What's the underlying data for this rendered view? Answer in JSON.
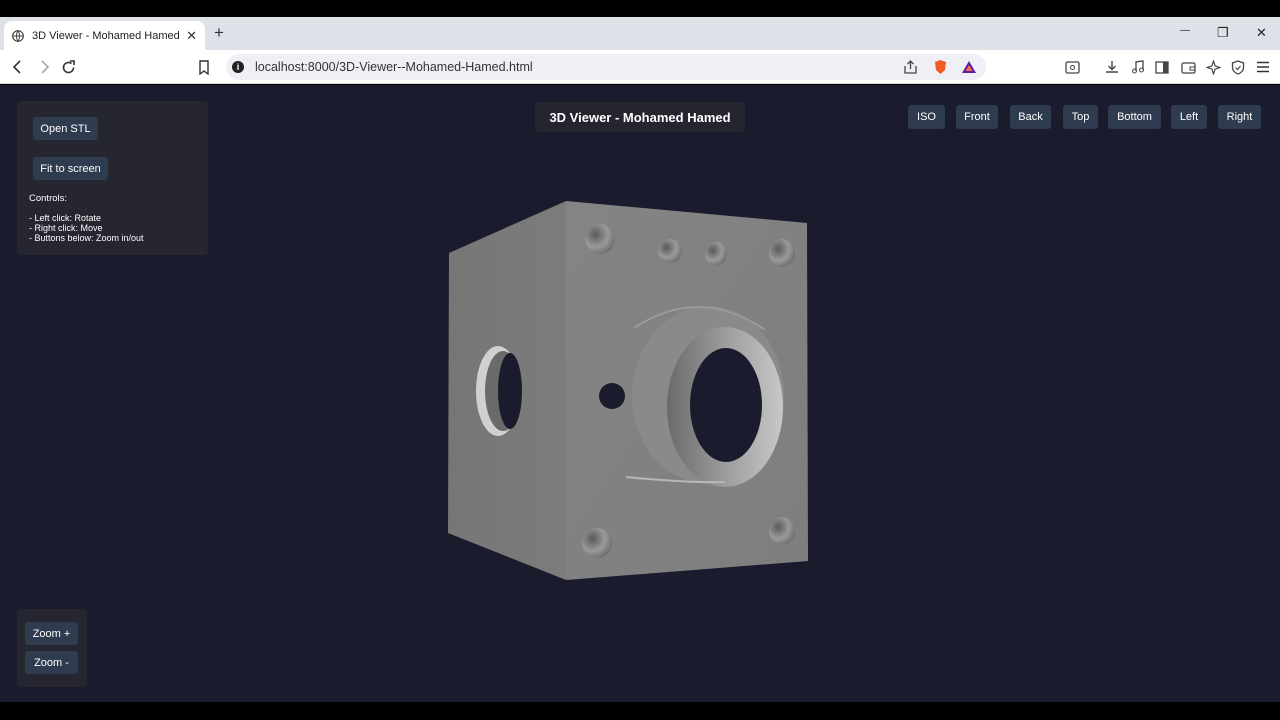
{
  "browser": {
    "tab_title": "3D Viewer - Mohamed Hamed",
    "tab_close": "✕",
    "new_tab": "+",
    "url": "localhost:8000/3D-Viewer--Mohamed-Hamed.html",
    "window_controls": {
      "minimize": "—",
      "restore": "❐",
      "close": "✕"
    }
  },
  "app": {
    "title": "3D Viewer - Mohamed Hamed",
    "left_panel": {
      "open_stl": "Open STL",
      "fit_to_screen": "Fit to screen",
      "controls_title": "Controls:",
      "controls_lines": [
        "- Left click: Rotate",
        "- Right click: Move",
        "- Buttons below: Zoom in/out"
      ]
    },
    "view_buttons": [
      "ISO",
      "Front",
      "Back",
      "Top",
      "Bottom",
      "Left",
      "Right"
    ],
    "zoom": {
      "zoom_in": "Zoom +",
      "zoom_out": "Zoom -"
    },
    "colors": {
      "background": "#1b1b2e",
      "button": "#2f3b4e",
      "panel": "#262630",
      "model_grey": "#808080"
    }
  }
}
